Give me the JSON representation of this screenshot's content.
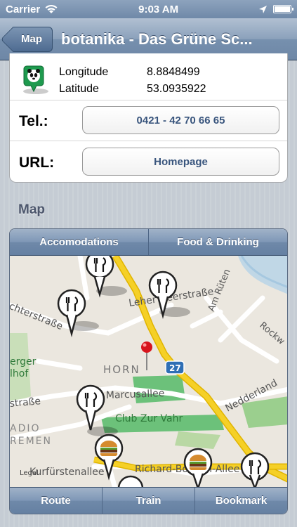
{
  "status": {
    "carrier": "Carrier",
    "time": "9:03 AM"
  },
  "nav": {
    "back_label": "Map",
    "title": "botanika - Das Grüne Sc..."
  },
  "location": {
    "longitude_label": "Longitude",
    "longitude_value": "8.8848499",
    "latitude_label": "Latitude",
    "latitude_value": "53.0935922"
  },
  "contact": {
    "tel_label": "Tel.:",
    "tel_value": "0421 - 42 70 66 65",
    "url_label": "URL:",
    "url_value": "Homepage"
  },
  "map_section": {
    "title": "Map",
    "filters": [
      "Accomodations",
      "Food & Drinking"
    ],
    "actions": [
      "Route",
      "Train",
      "Bookmark"
    ],
    "legal": "Legal",
    "labels": {
      "street1": "Leher Heerstraße",
      "street2": "Am Rüten",
      "street3": "Rockw",
      "street4": "chterstraße",
      "street5": "erger",
      "street6": "lhof",
      "district": "HORN",
      "road_number": "27",
      "street7": "Marcusallee",
      "street8": "straße",
      "club": "Club Zur Vahr",
      "street9": "Nedderland",
      "radio1": "ADIO",
      "radio2": "REMEN",
      "street10": "Kurfürstenallee",
      "street11": "Richard-Boljahn-Allee"
    }
  },
  "colors": {
    "nav_blue": "#6e87a6",
    "button_text": "#39557d",
    "road_yellow": "#f5d027",
    "park_green": "#6cc17a",
    "pin_red": "#d7141c"
  }
}
